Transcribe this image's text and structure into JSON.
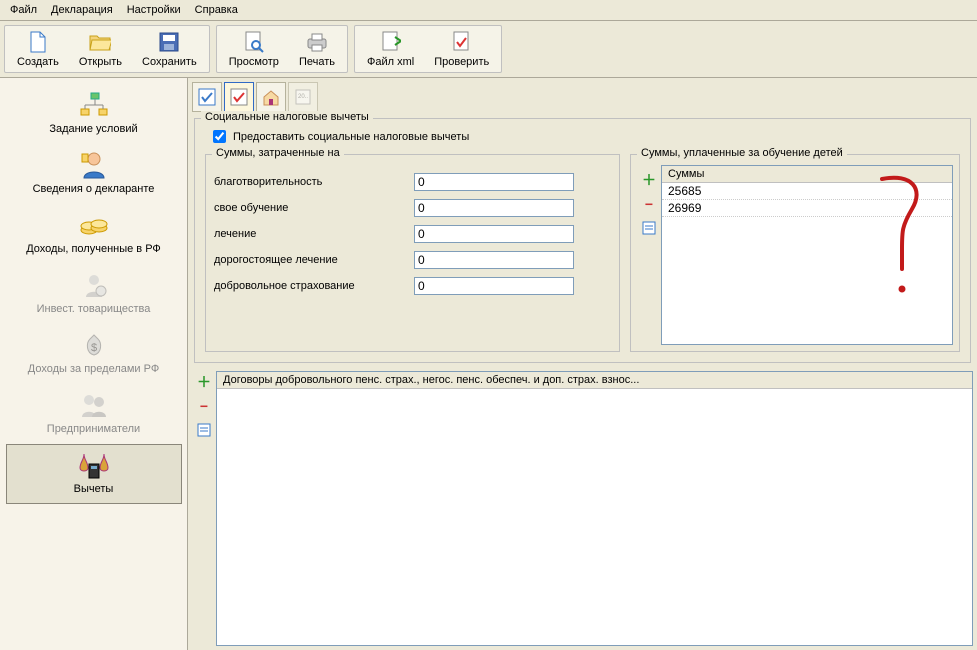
{
  "menu": {
    "file": "Файл",
    "declaration": "Декларация",
    "settings": "Настройки",
    "help": "Справка"
  },
  "toolbar": {
    "create": "Создать",
    "open": "Открыть",
    "save": "Сохранить",
    "preview": "Просмотр",
    "print": "Печать",
    "xml": "Файл xml",
    "check": "Проверить"
  },
  "sidebar": {
    "conditions": "Задание условий",
    "declarant": "Сведения о декларанте",
    "income_rf": "Доходы, полученные в РФ",
    "invest": "Инвест. товарищества",
    "income_foreign": "Доходы за пределами РФ",
    "entrepreneurs": "Предприниматели",
    "deductions": "Вычеты"
  },
  "social": {
    "group_title": "Социальные налоговые вычеты",
    "checkbox_label": "Предоставить социальные налоговые вычеты",
    "checked": true
  },
  "sums_spent": {
    "title": "Суммы, затраченные на",
    "charity_label": "благотворительность",
    "charity_value": "0",
    "education_label": "свое обучение",
    "education_value": "0",
    "treatment_label": "лечение",
    "treatment_value": "0",
    "expensive_treatment_label": "дорогостоящее лечение",
    "expensive_treatment_value": "0",
    "insurance_label": "добровольное страхование",
    "insurance_value": "0"
  },
  "children_education": {
    "title": "Суммы, уплаченные за обучение детей",
    "header": "Суммы",
    "rows": [
      "25685",
      "26969"
    ]
  },
  "contracts": {
    "header": "Договоры добровольного пенс. страх., негос. пенс. обеспеч. и доп. страх. взнос..."
  }
}
